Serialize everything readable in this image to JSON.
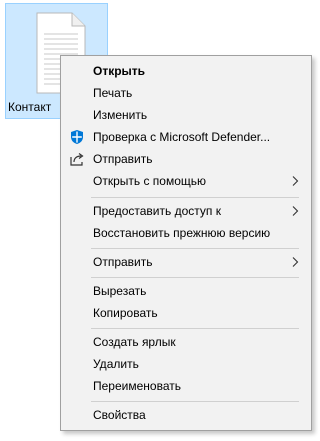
{
  "file": {
    "label": "Контакт"
  },
  "menu": {
    "open": "Открыть",
    "print": "Печать",
    "edit": "Изменить",
    "defender": "Проверка с Microsoft Defender...",
    "share": "Отправить",
    "open_with": "Открыть с помощью",
    "give_access": "Предоставить доступ к",
    "restore": "Восстановить прежнюю версию",
    "send_to": "Отправить",
    "cut": "Вырезать",
    "copy": "Копировать",
    "create_shortcut": "Создать ярлык",
    "delete": "Удалить",
    "rename": "Переименовать",
    "properties": "Свойства"
  },
  "colors": {
    "selection_bg": "#cce8ff",
    "selection_border": "#99d1ff",
    "menu_bg": "#f2f2f2",
    "defender_blue": "#0078d7"
  },
  "icons": {
    "defender": "defender-shield-icon",
    "share": "share-icon",
    "submenu": "chevron-right-icon",
    "file": "text-file-icon"
  }
}
